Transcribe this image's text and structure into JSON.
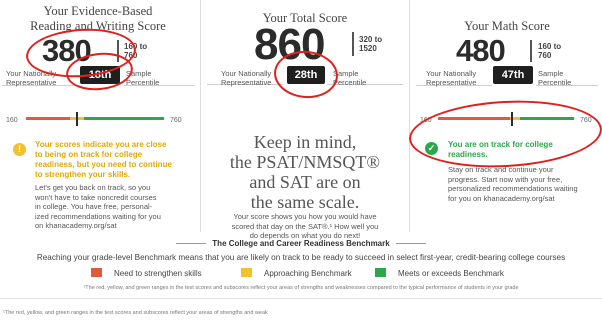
{
  "colors": {
    "red": "#e25a3c",
    "yellow": "#f2c12e",
    "green": "#2aa84a",
    "annotation": "#e0201d"
  },
  "erw": {
    "title_l1": "Your Evidence-Based",
    "title_l2": "Reading and Writing Score",
    "score": "380",
    "range_l1": "160 to",
    "range_l2": "760",
    "np_l1": "Your Nationally",
    "np_l2": "Representative",
    "percentile": "18th",
    "sp_l1": "Sample",
    "sp_l2": "Percentile",
    "scale_min": "160",
    "scale_max": "760",
    "scale_value": 380,
    "msg_icon": "!",
    "msg_icon_name": "warning-icon",
    "msg": [
      "Your scores indicate you are close",
      "to being on track for college",
      "readiness, but you need to continue",
      "to strengthen your skills."
    ],
    "body": [
      "Let's get you back on track, so you",
      "won't have to take noncredit courses",
      "in college. You have free, personal-",
      "ized recommendations waiting for you",
      "on khanacademy.org/sat"
    ]
  },
  "total": {
    "title": "Your Total Score",
    "score": "860",
    "range_l1": "320 to",
    "range_l2": "1520",
    "np_l1": "Your Nationally",
    "np_l2": "Representative",
    "percentile": "28th",
    "sp_l1": "Sample",
    "sp_l2": "Percentile",
    "message": [
      "Keep in mind,",
      "the PSAT/NMSQT®",
      "and SAT are on",
      "the same scale."
    ],
    "note": [
      "Your score shows you how you would have",
      "scored that day on the SAT®.¹ How well you",
      "do depends on what you do next!"
    ]
  },
  "math": {
    "title": "Your Math Score",
    "score": "480",
    "range_l1": "160 to",
    "range_l2": "760",
    "np_l1": "Your Nationally",
    "np_l2": "Representative",
    "percentile": "47th",
    "sp_l1": "Sample",
    "sp_l2": "Percentile",
    "scale_min": "160",
    "scale_max": "760",
    "scale_value": 480,
    "msg_icon": "✓",
    "msg_icon_name": "checkmark-icon",
    "msg": [
      "You are on track for college",
      "readiness."
    ],
    "body": [
      "Stay on track and continue your",
      "progress. Start now with your free,",
      "personalized recommendations waiting",
      "for you on khanacademy.org/sat"
    ]
  },
  "benchmark": {
    "title": "The College and Career Readiness Benchmark",
    "subtitle": "Reaching your grade-level Benchmark means that you are likely on track to be ready to succeed in select first-year, credit-bearing college courses",
    "legend": [
      "Need to strengthen skills",
      "Approaching Benchmark",
      "Meets or exceeds Benchmark"
    ],
    "footnote": "¹The red, yellow, and green ranges in the test scores and subscores reflect your areas of strengths and weaknesses compared to the typical performance of students in your grade",
    "footnote2": "¹The red, yellow, and green ranges in the test scores and subscores reflect your areas of strengths and weak"
  }
}
